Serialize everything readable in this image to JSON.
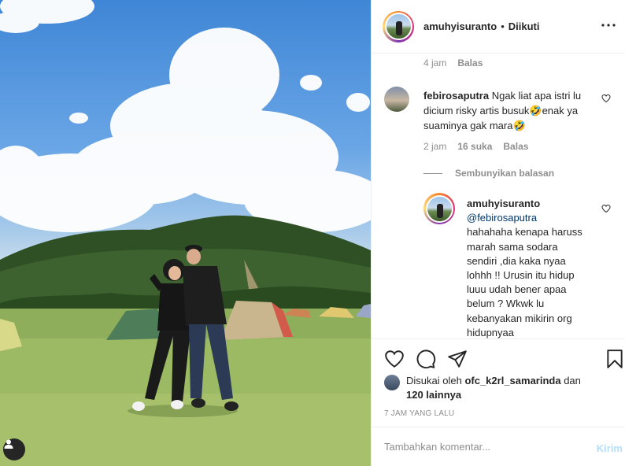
{
  "post": {
    "username": "amuhyisuranto",
    "dot": "•",
    "follow_status": "Diikuti"
  },
  "comments": {
    "top_meta": {
      "time": "4 jam",
      "reply": "Balas"
    },
    "comment1": {
      "username": "febirosaputra",
      "text_line1": "Ngak liat apa istri lu",
      "text_line2": "dicium risky artis busuk",
      "text_line2b": "enak ya",
      "text_line3": "suaminya gak mara",
      "emoji": "🤣",
      "time": "2 jam",
      "likes": "16 suka",
      "reply": "Balas"
    },
    "hide_replies": "Sembunyikan balasan",
    "reply1": {
      "username": "amuhyisuranto",
      "mention": "@febirosaputra",
      "lines": [
        "hahahaha kenapa haruss",
        "marah sama sodara",
        "sendiri ,dia kaka nyaa",
        "lohhh !! Urusin itu hidup",
        "luuu udah bener apaa",
        "belum ? Wkwk lu",
        "kebanyakan mikirin org",
        "hidupnyaa"
      ]
    }
  },
  "likes": {
    "prefix": "Disukai oleh",
    "user": "ofc_k2rl_samarinda",
    "conj": "dan",
    "others": "120 lainnya"
  },
  "timestamp": "7 JAM YANG LALU",
  "add_comment": {
    "placeholder": "Tambahkan komentar...",
    "post_label": "Kirim"
  },
  "icons": {
    "like": "heart-icon",
    "comment": "comment-icon",
    "share": "share-icon",
    "save": "bookmark-icon",
    "more": "more-icon",
    "user_tag": "user-tag-icon"
  },
  "colors": {
    "text": "#262626",
    "muted": "#8e8e8e",
    "border": "#efefef",
    "post_button_disabled": "#b2dffc"
  }
}
